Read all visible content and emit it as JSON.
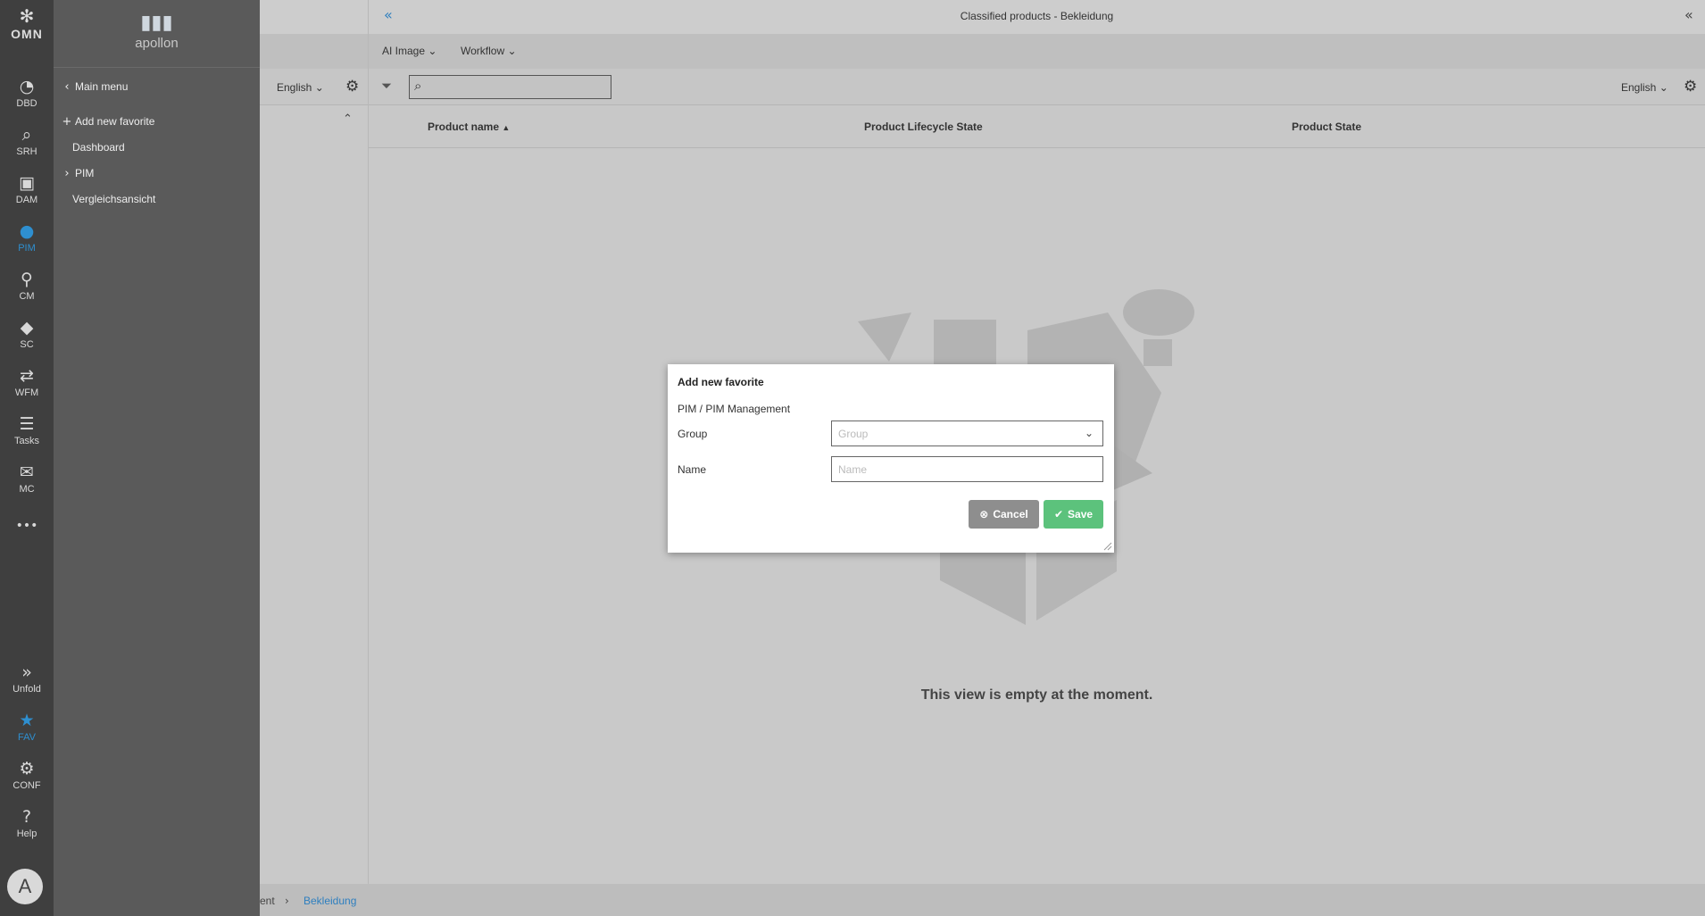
{
  "rail": {
    "logo": "OMN",
    "items": [
      {
        "label": "DBD",
        "icon": "dashboard-gauge-icon"
      },
      {
        "label": "SRH",
        "icon": "search-icon"
      },
      {
        "label": "DAM",
        "icon": "images-icon"
      },
      {
        "label": "PIM",
        "icon": "pim-user-icon"
      },
      {
        "label": "CM",
        "icon": "share-nodes-icon"
      },
      {
        "label": "SC",
        "icon": "cube-icon"
      },
      {
        "label": "WFM",
        "icon": "workflow-icon"
      },
      {
        "label": "Tasks",
        "icon": "tasks-list-icon"
      },
      {
        "label": "MC",
        "icon": "envelope-icon"
      }
    ],
    "more": "•••",
    "unfold": "Unfold",
    "fav": "FAV",
    "conf": "CONF",
    "help": "Help",
    "avatar": "A"
  },
  "menu": {
    "brand": "apollon",
    "main_menu": "Main menu",
    "add_favorite": "Add new favorite",
    "items": [
      "Dashboard",
      "PIM",
      "Vergleichsansicht"
    ]
  },
  "header": {
    "title": "Classified products - Bekleidung",
    "toolbar": {
      "ai_image": "AI Image",
      "workflow": "Workflow"
    },
    "lang_left": "English",
    "lang_right": "English"
  },
  "table": {
    "columns": [
      "Product name",
      "Product Lifecycle State",
      "Product State"
    ],
    "empty_message": "This view is empty at the moment."
  },
  "breadcrumb": {
    "partial": "ent",
    "current": "Bekleidung"
  },
  "modal": {
    "title": "Add new favorite",
    "path": "PIM / PIM Management",
    "group_label": "Group",
    "group_placeholder": "Group",
    "name_label": "Name",
    "name_placeholder": "Name",
    "cancel": "Cancel",
    "save": "Save"
  },
  "colors": {
    "accent": "#2e8fd0",
    "save": "#5cc27c",
    "cancel": "#8e8e8e"
  }
}
